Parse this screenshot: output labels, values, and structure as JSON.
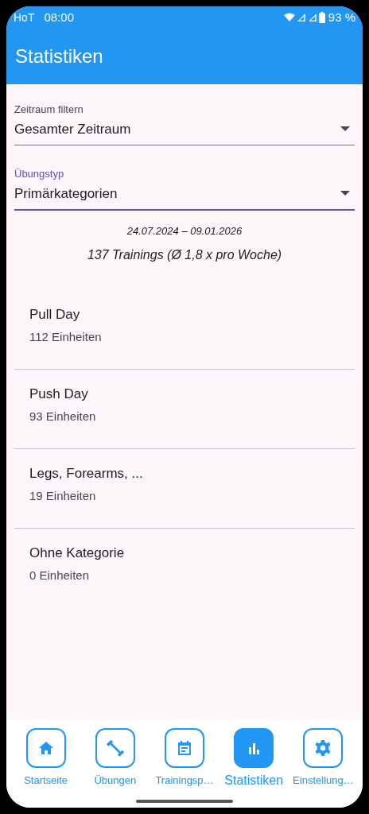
{
  "status_bar": {
    "carrier": "HoT",
    "time": "08:00",
    "battery": "93 %"
  },
  "app_bar": {
    "title": "Statistiken"
  },
  "filters": [
    {
      "label": "Zeitraum filtern",
      "value": "Gesamter Zeitraum",
      "focused": false
    },
    {
      "label": "Übungstyp",
      "value": "Primärkategorien",
      "focused": true
    }
  ],
  "summary": {
    "date_range": "24.07.2024 – 09.01.2026",
    "trainings": "137 Trainings (Ø 1,8 x pro Woche)"
  },
  "categories": [
    {
      "title": "Pull Day",
      "count": "112 Einheiten"
    },
    {
      "title": "Push Day",
      "count": "93 Einheiten"
    },
    {
      "title": "Legs, Forearms, ...",
      "count": "19 Einheiten"
    },
    {
      "title": "Ohne Kategorie",
      "count": "0 Einheiten"
    }
  ],
  "bottom_nav": [
    {
      "label": "Startseite",
      "kind": "home",
      "selected": false
    },
    {
      "label": "Übungen",
      "kind": "dumbbell",
      "selected": false
    },
    {
      "label": "Trainingsp…",
      "kind": "calendar",
      "selected": false
    },
    {
      "label": "Statistiken",
      "kind": "chart",
      "selected": true
    },
    {
      "label": "Einstellung…",
      "kind": "gear",
      "selected": false
    }
  ]
}
